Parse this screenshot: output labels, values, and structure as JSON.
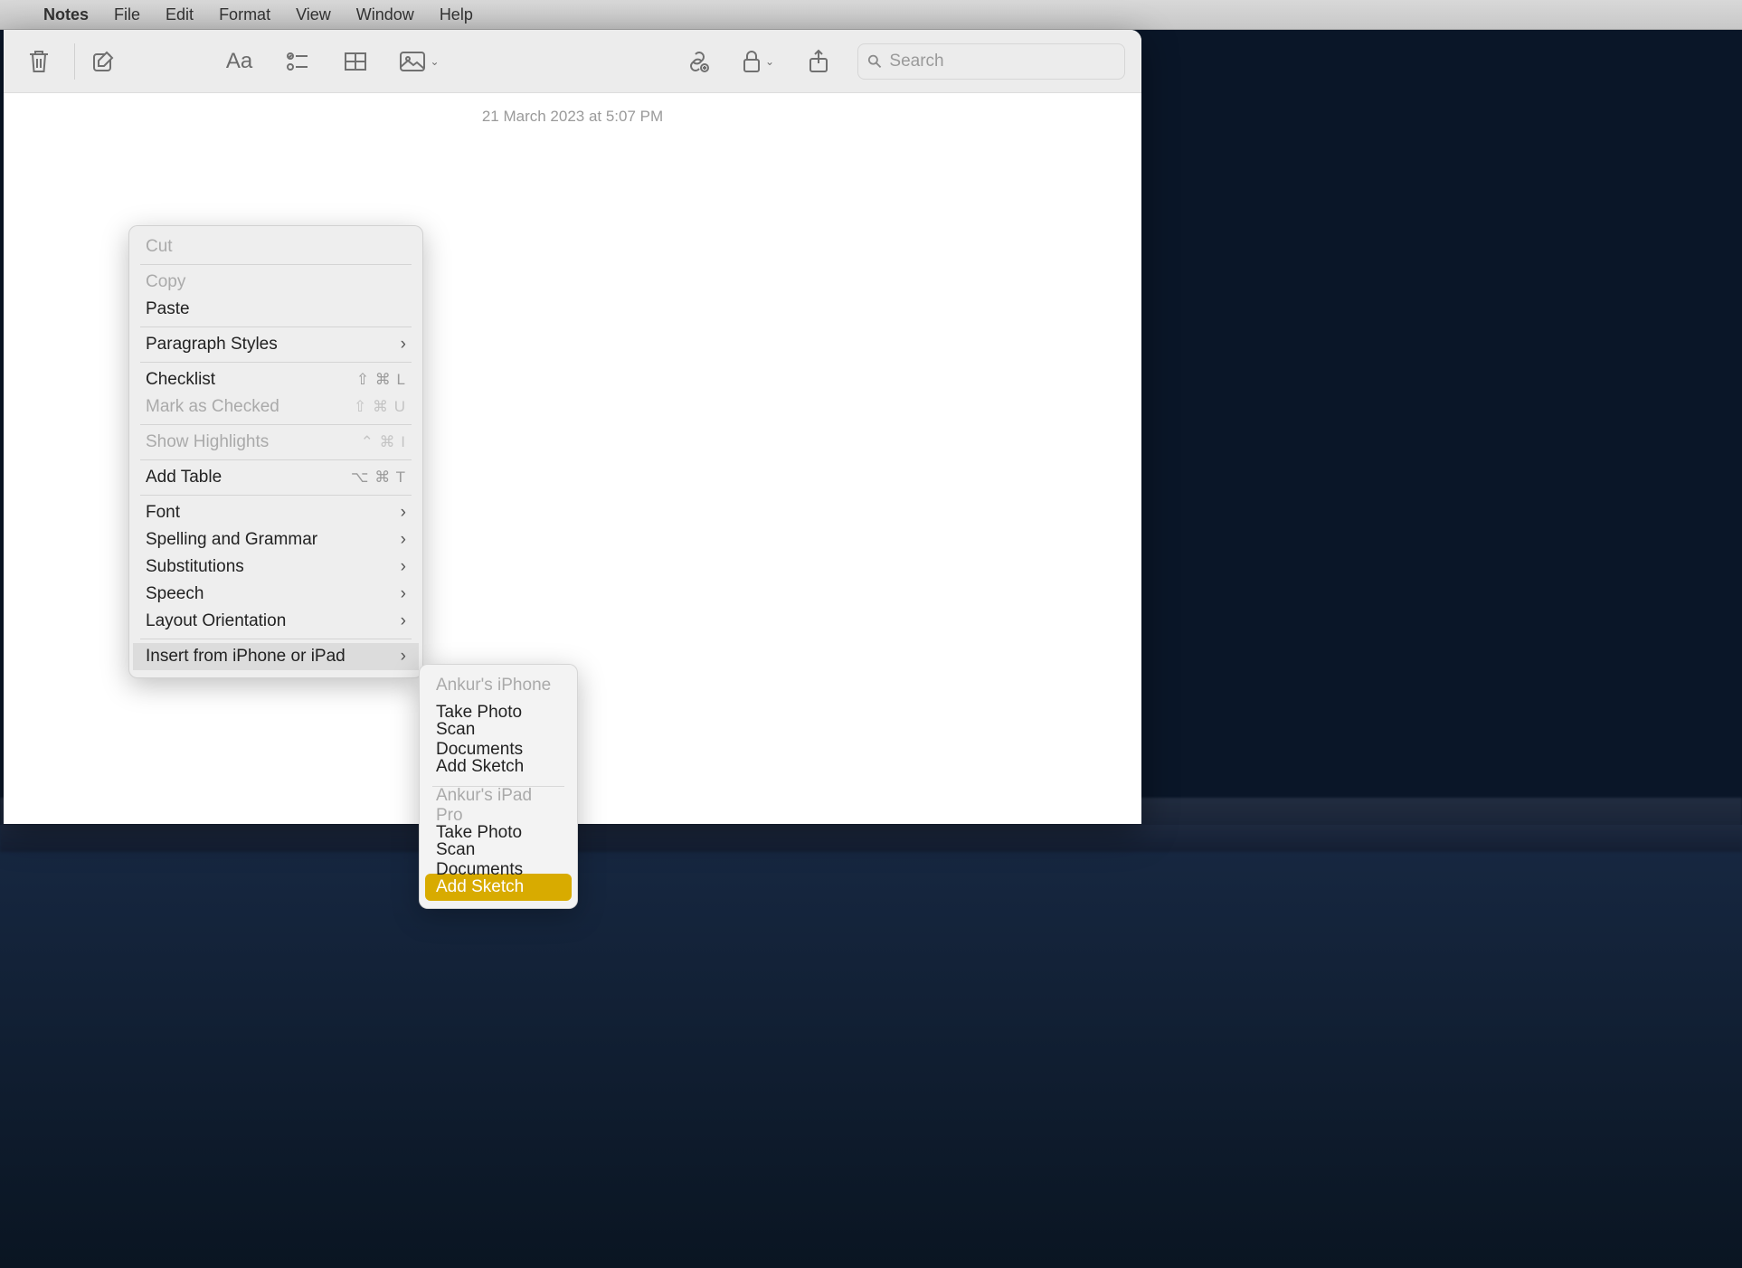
{
  "menubar": {
    "app": "Notes",
    "items": [
      "File",
      "Edit",
      "Format",
      "View",
      "Window",
      "Help"
    ]
  },
  "toolbar": {
    "search_placeholder": "Search"
  },
  "note": {
    "timestamp": "21 March 2023 at 5:07 PM"
  },
  "context_menu": {
    "cut": "Cut",
    "copy": "Copy",
    "paste": "Paste",
    "paragraph_styles": "Paragraph Styles",
    "checklist": {
      "label": "Checklist",
      "shortcut": "⇧ ⌘ L"
    },
    "mark_checked": {
      "label": "Mark as Checked",
      "shortcut": "⇧ ⌘ U"
    },
    "show_highlights": {
      "label": "Show Highlights",
      "shortcut": "⌃ ⌘ I"
    },
    "add_table": {
      "label": "Add Table",
      "shortcut": "⌥ ⌘ T"
    },
    "font": "Font",
    "spelling": "Spelling and Grammar",
    "substitutions": "Substitutions",
    "speech": "Speech",
    "layout": "Layout Orientation",
    "insert_device": "Insert from iPhone or iPad"
  },
  "submenu": {
    "device1": "Ankur's iPhone",
    "device1_actions": [
      "Take Photo",
      "Scan Documents",
      "Add Sketch"
    ],
    "device2": "Ankur's iPad Pro",
    "device2_actions": [
      "Take Photo",
      "Scan Documents",
      "Add Sketch"
    ]
  }
}
